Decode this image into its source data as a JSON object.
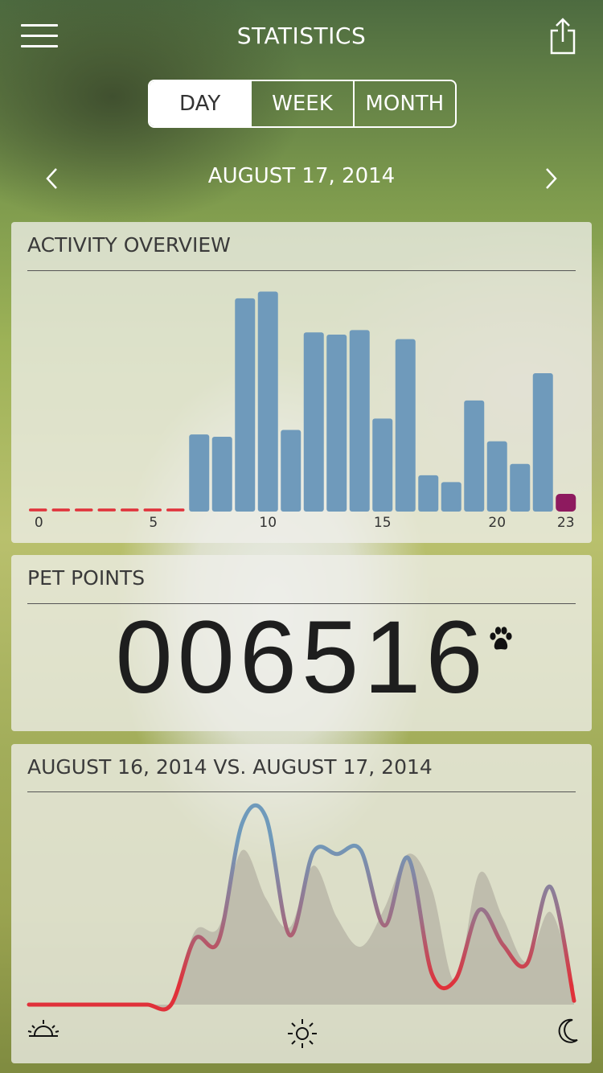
{
  "header": {
    "title": "STATISTICS",
    "menu_icon": "hamburger-menu-icon",
    "share_icon": "share-icon"
  },
  "segments": [
    {
      "label": "DAY",
      "active": true
    },
    {
      "label": "WEEK",
      "active": false
    },
    {
      "label": "MONTH",
      "active": false
    }
  ],
  "date_nav": {
    "date": "AUGUST 17, 2014",
    "prev_icon": "chevron-left-icon",
    "next_icon": "chevron-right-icon"
  },
  "activity": {
    "title": "ACTIVITY OVERVIEW",
    "chart_data": {
      "type": "bar",
      "title": "ACTIVITY OVERVIEW",
      "xlabel": "",
      "ylabel": "",
      "categories": [
        0,
        1,
        2,
        3,
        4,
        5,
        6,
        7,
        8,
        9,
        10,
        11,
        12,
        13,
        14,
        15,
        16,
        17,
        18,
        19,
        20,
        21,
        22,
        23
      ],
      "x_tick_labels": [
        "0",
        "5",
        "10",
        "15",
        "20",
        "23"
      ],
      "x_ticks": [
        0,
        5,
        10,
        15,
        20,
        23
      ],
      "values": [
        0,
        0,
        0,
        0,
        0,
        0,
        0,
        34,
        33,
        94,
        97,
        36,
        79,
        78,
        80,
        41,
        76,
        16,
        13,
        49,
        31,
        21,
        61,
        2
      ],
      "ylim": [
        0,
        100
      ],
      "grid": false,
      "bar_color": "#6f9abb",
      "zero_color": "#e0313a",
      "current_color": "#8e1a5f",
      "current_index": 23
    }
  },
  "points": {
    "title": "PET POINTS",
    "value": "006516",
    "icon": "paw-icon"
  },
  "compare": {
    "title": "AUGUST 16, 2014 VS. AUGUST 17, 2014",
    "chart_data": {
      "type": "area",
      "title": "AUGUST 16, 2014 VS. AUGUST 17, 2014",
      "xlabel": "",
      "ylabel": "",
      "x": [
        0,
        1,
        2,
        3,
        4,
        5,
        6,
        7,
        8,
        9,
        10,
        11,
        12,
        13,
        14,
        15,
        16,
        17,
        18,
        19,
        20,
        21,
        22,
        23
      ],
      "ylim": [
        0,
        100
      ],
      "series": [
        {
          "values": [
            0,
            0,
            0,
            0,
            0,
            0,
            0,
            34,
            33,
            94,
            97,
            36,
            79,
            78,
            80,
            41,
            76,
            16,
            13,
            49,
            31,
            21,
            61,
            2
          ],
          "color": "#6f9abb",
          "style": "line"
        },
        {
          "values": [
            0,
            0,
            0,
            0,
            0,
            0,
            0,
            38,
            40,
            80,
            55,
            40,
            72,
            45,
            30,
            50,
            78,
            60,
            12,
            68,
            45,
            22,
            48,
            10
          ],
          "color": "#a8a398",
          "style": "area"
        }
      ],
      "x_axis_icons": [
        "sunrise-icon",
        "sun-icon",
        "moon-icon"
      ],
      "line_gradient": [
        "#6f9abb",
        "#e0313a"
      ]
    }
  }
}
